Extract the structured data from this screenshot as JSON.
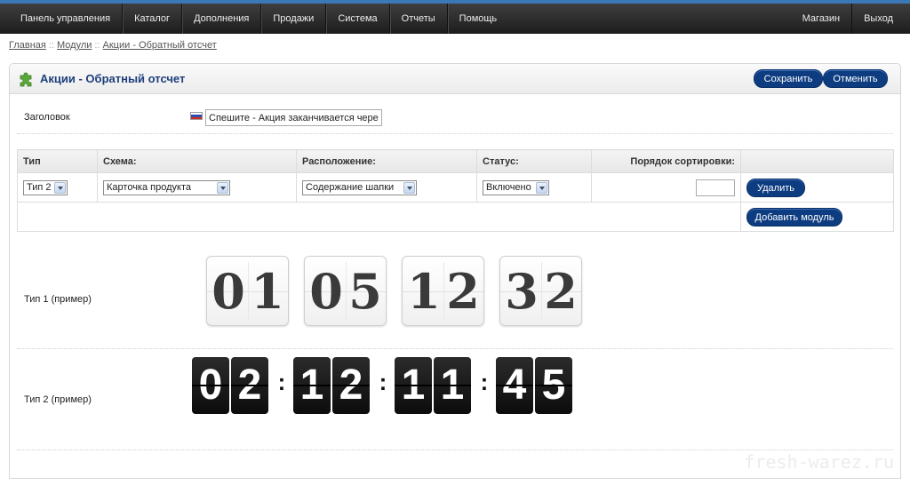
{
  "nav": {
    "left": [
      "Панель управления",
      "Каталог",
      "Дополнения",
      "Продажи",
      "Система",
      "Отчеты",
      "Помощь"
    ],
    "right": [
      "Магазин",
      "Выход"
    ]
  },
  "breadcrumb": [
    "Главная",
    "Модули",
    "Акции - Обратный отсчет"
  ],
  "breadcrumb_sep": "::",
  "header": {
    "title": "Акции - Обратный отсчет",
    "save_label": "Сохранить",
    "cancel_label": "Отменить"
  },
  "form": {
    "title_label": "Заголовок",
    "title_value": "Спешите - Акция заканчивается через:"
  },
  "table": {
    "headers": [
      "Тип",
      "Схема:",
      "Расположение:",
      "Статус:",
      "Порядок сортировки:"
    ],
    "row": {
      "type": "Тип 2",
      "layout": "Карточка продукта",
      "position": "Содержание шапки",
      "status": "Включено",
      "sort_order": ""
    },
    "delete_label": "Удалить",
    "add_module_label": "Добавить модуль"
  },
  "examples": {
    "type1_label": "Тип 1 (пример)",
    "type1_digits": [
      "0",
      "1",
      "0",
      "5",
      "1",
      "2",
      "3",
      "2"
    ],
    "type2_label": "Тип 2 (пример)",
    "type2_digits": [
      "0",
      "2",
      "1",
      "2",
      "1",
      "1",
      "4",
      "5"
    ],
    "type2_separator": ":"
  },
  "watermark": "fresh-warez.ru",
  "colors": {
    "accent": "#0d3c80",
    "topbar": "#2a2a2a",
    "topbar_stripe": "#3a78b8",
    "title": "#1d3f7a"
  },
  "icons": {
    "module_icon": "puzzle-piece-icon",
    "flag": "russian-flag-icon",
    "dropdown": "chevron-down-icon"
  }
}
